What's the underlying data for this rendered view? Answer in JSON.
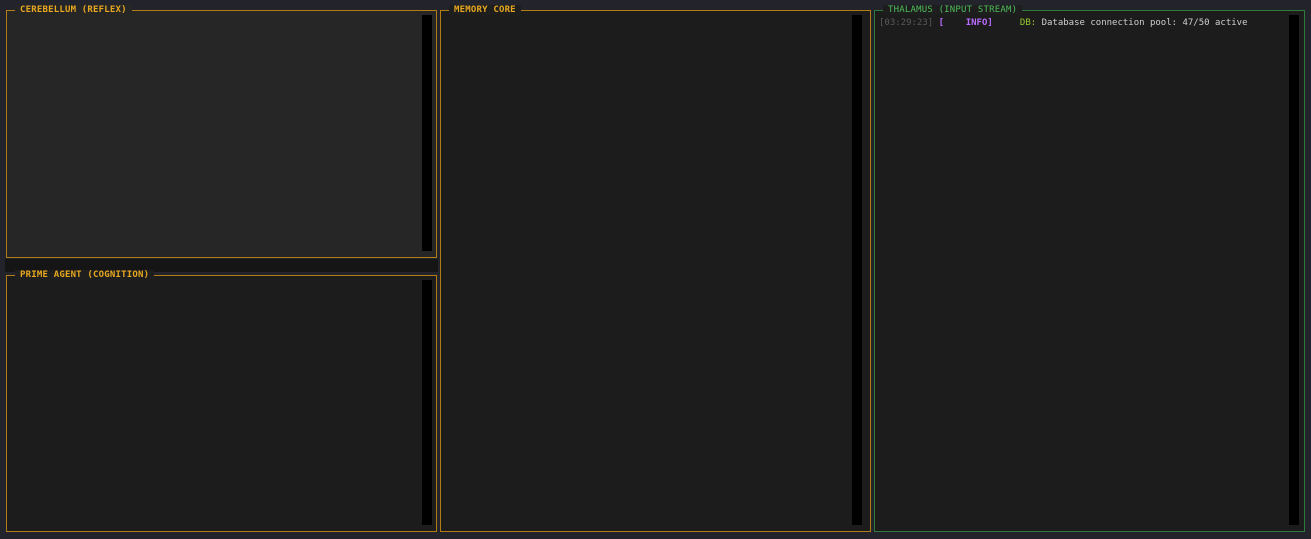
{
  "panels": {
    "cerebellum": {
      "title": "CEREBELLUM (REFLEX)"
    },
    "prime_agent": {
      "title": "PRIME AGENT (COGNITION)"
    },
    "memory_core": {
      "title": "MEMORY CORE"
    },
    "thalamus": {
      "title": "THALAMUS (INPUT STREAM)",
      "log": [
        {
          "timestamp": "[03:29:23]",
          "level_open": "[",
          "level": "    INFO]",
          "source": "DB:",
          "message": "Database connection pool: 47/50 active"
        }
      ]
    }
  },
  "colors": {
    "background": "#23232b",
    "panel_bg": "#1c1c1c",
    "amber_border": "#b37c14",
    "amber_title": "#e8a820",
    "green_border": "#2d7a3a",
    "green_title": "#4fbf5c",
    "log_level": "#b96bff",
    "log_source": "#9acd32"
  }
}
